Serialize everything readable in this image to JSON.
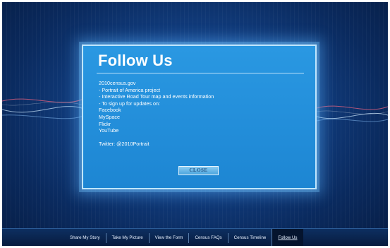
{
  "modal": {
    "title": "Follow Us",
    "lines": [
      "2010census.gov",
      "- Portrait of America project",
      "- Interactive Road Tour map and events information",
      "- To sign up for updates on:",
      "Facebook",
      "MySpace",
      "Flickr",
      "YouTube"
    ],
    "twitter": "Twitter: @2010Portrait",
    "close_label": "CLOSE"
  },
  "nav": {
    "items": [
      "Share My Story",
      "Take My Picture",
      "View the Form",
      "Census FAQs",
      "Census Timeline",
      "Follow Us"
    ],
    "active": "Follow Us"
  },
  "colors": {
    "background": "#123f82",
    "modal": "#1d86d3",
    "modal_border": "#bfe6ff",
    "nav": "#0a234a",
    "wave_red": "#e0607e",
    "wave_light": "#cfeaff"
  }
}
